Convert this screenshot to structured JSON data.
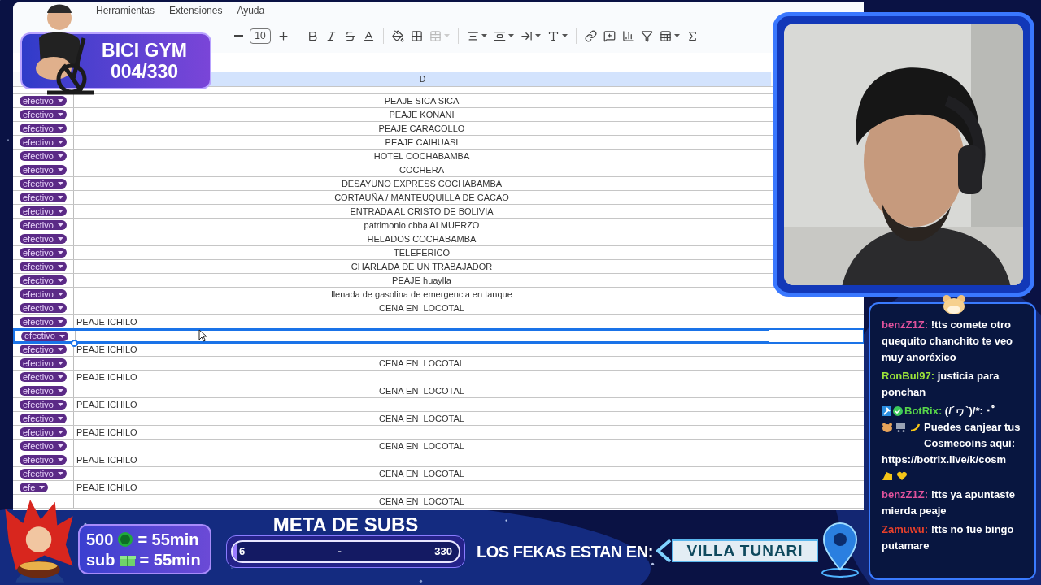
{
  "menu": [
    "Herramientas",
    "Extensiones",
    "Ayuda"
  ],
  "toolbar": {
    "font_size": "10"
  },
  "column_header": "D",
  "rows": [
    {
      "payment": "efectivo",
      "description": "PEAJE SICA SICA",
      "kind": "centered",
      "selected": false
    },
    {
      "payment": "efectivo",
      "description": "PEAJE KONANI",
      "kind": "centered",
      "selected": false
    },
    {
      "payment": "efectivo",
      "description": "PEAJE CARACOLLO",
      "kind": "centered",
      "selected": false
    },
    {
      "payment": "efectivo",
      "description": "PEAJE CAIHUASI",
      "kind": "centered",
      "selected": false
    },
    {
      "payment": "efectivo",
      "description": "HOTEL COCHABAMBA",
      "kind": "centered",
      "selected": false
    },
    {
      "payment": "efectivo",
      "description": "COCHERA",
      "kind": "centered",
      "selected": false
    },
    {
      "payment": "efectivo",
      "description": "DESAYUNO EXPRESS COCHABAMBA",
      "kind": "centered",
      "selected": false
    },
    {
      "payment": "efectivo",
      "description": "CORTAUÑA / MANTEUQUILLA DE CACAO",
      "kind": "centered",
      "selected": false
    },
    {
      "payment": "efectivo",
      "description": "ENTRADA AL CRISTO DE BOLIVIA",
      "kind": "centered",
      "selected": false
    },
    {
      "payment": "efectivo",
      "description": "patrimonio cbba ALMUERZO",
      "kind": "centered",
      "selected": false
    },
    {
      "payment": "efectivo",
      "description": "HELADOS COCHABAMBA",
      "kind": "centered",
      "selected": false
    },
    {
      "payment": "efectivo",
      "description": "TELEFERICO",
      "kind": "centered",
      "selected": false
    },
    {
      "payment": "efectivo",
      "description": "CHARLADA DE UN TRABAJADOR",
      "kind": "centered",
      "selected": false
    },
    {
      "payment": "efectivo",
      "description": "PEAJE huaylla",
      "kind": "centered",
      "selected": false
    },
    {
      "payment": "efectivo",
      "description": "llenada de gasolina de emergencia en tanque",
      "kind": "centered",
      "selected": false
    },
    {
      "payment": "efectivo",
      "description": "CENA EN  LOCOTAL",
      "kind": "centered",
      "selected": false
    },
    {
      "payment": "efectivo",
      "description": "PEAJE ICHILO",
      "kind": "left",
      "selected": false
    },
    {
      "payment": "efectivo",
      "kind": "centered",
      "selected": true
    },
    {
      "payment": "efectivo",
      "description": "PEAJE ICHILO",
      "kind": "left",
      "selected": false
    },
    {
      "payment": "efectivo",
      "description": "CENA EN  LOCOTAL",
      "kind": "centered",
      "selected": false
    },
    {
      "payment": "efectivo",
      "description": "PEAJE ICHILO",
      "kind": "left",
      "selected": false
    },
    {
      "payment": "efectivo",
      "description": "CENA EN  LOCOTAL",
      "kind": "centered",
      "selected": false
    },
    {
      "payment": "efectivo",
      "description": "PEAJE ICHILO",
      "kind": "left",
      "selected": false
    },
    {
      "payment": "efectivo",
      "description": "CENA EN  LOCOTAL",
      "kind": "centered",
      "selected": false
    },
    {
      "payment": "efectivo",
      "description": "PEAJE ICHILO",
      "kind": "left",
      "selected": false
    },
    {
      "payment": "efectivo",
      "description": "CENA EN  LOCOTAL",
      "kind": "centered",
      "selected": false
    },
    {
      "payment": "efectivo",
      "description": "PEAJE ICHILO",
      "kind": "left",
      "selected": false
    },
    {
      "payment": "efectivo",
      "description": "CENA EN  LOCOTAL",
      "kind": "centered",
      "selected": false
    },
    {
      "payment": "efe",
      "description": "PEAJE ICHILO",
      "kind": "left",
      "selected": false
    },
    {
      "description": "CENA EN  LOCOTAL",
      "kind": "centered",
      "selected": false
    }
  ],
  "gym_badge": {
    "title": "BICI GYM",
    "count": "004/330"
  },
  "chat": [
    {
      "user": "benzZ1Z:",
      "color": "#e0529c",
      "text": "!tts comete otro quequito chanchito te veo muy anoréxico",
      "kind": "user"
    },
    {
      "user": "RonBul97:",
      "color": "#9be33a",
      "text": "justicia para ponchan",
      "kind": "user"
    },
    {
      "user": "BotRix:",
      "color": "#58d64a",
      "text": "(/´ヮ`)/*: ･ﾟ",
      "text2": "Puedes canjear tus Cosmecoins aqui:",
      "link": "https://botrix.live/k/cosm",
      "kind": "bot"
    },
    {
      "user": "benzZ1Z:",
      "color": "#e0529c",
      "text": "!tts ya apuntaste mierda peaje",
      "kind": "user"
    },
    {
      "user": "Zamuwu:",
      "color": "#e8402a",
      "text": "!tts no fue bingo putamare",
      "kind": "user"
    }
  ],
  "rewards": [
    {
      "amount": "500",
      "kind": "coin",
      "rate": "= 55min"
    },
    {
      "amount": "sub",
      "kind": "gift",
      "rate": "= 55min"
    }
  ],
  "sub_goal": {
    "title": "META DE SUBS",
    "current": "6",
    "separator": "-",
    "target": "330",
    "level": 0.018
  },
  "location": {
    "label": "LOS FEKAS ESTAN EN:",
    "place": "VILLA TUNARI"
  }
}
